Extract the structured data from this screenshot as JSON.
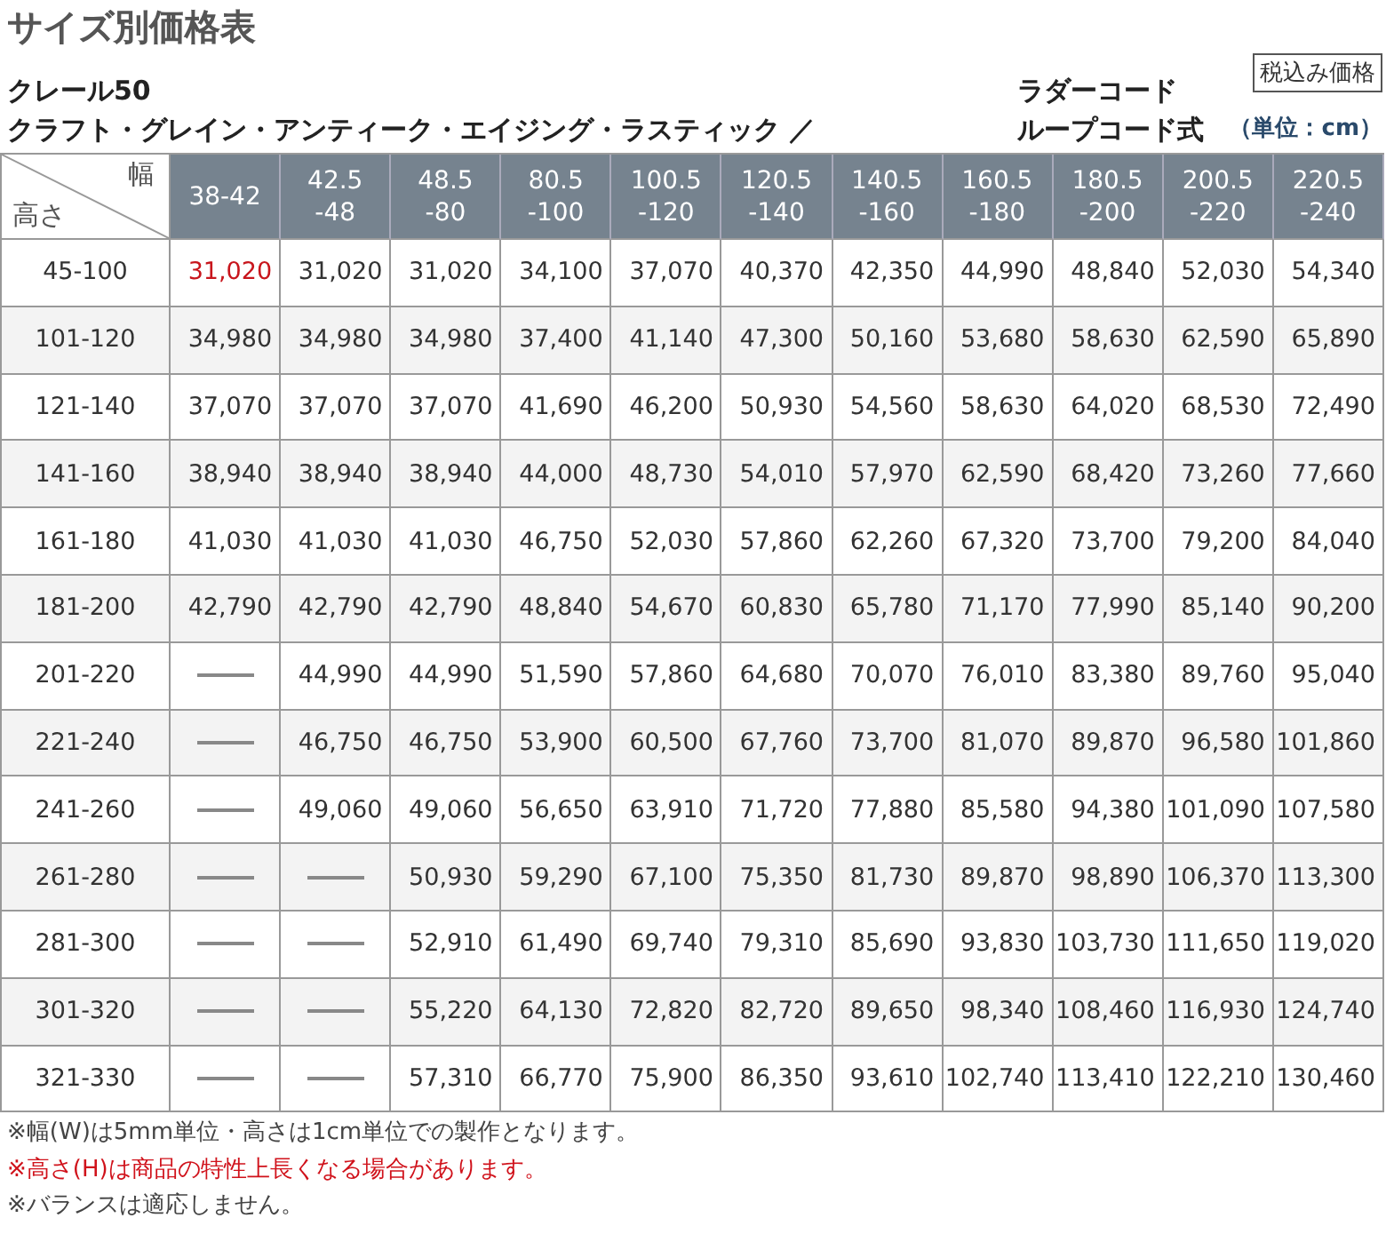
{
  "title": "サイズ別価格表",
  "product": {
    "name": "クレール50",
    "variants": "クラフト・グレイン・アンティーク・エイジング・ラスティック ／",
    "cord_lines": [
      "ラダーコード",
      "ループコード式"
    ],
    "tax_badge": "税込み価格",
    "unit": "（単位：cm）"
  },
  "table": {
    "corner_width": "幅",
    "corner_height": "高さ",
    "columns": [
      "38-42",
      "42.5\n-48",
      "48.5\n-80",
      "80.5\n-100",
      "100.5\n-120",
      "120.5\n-140",
      "140.5\n-160",
      "160.5\n-180",
      "180.5\n-200",
      "200.5\n-220",
      "220.5\n-240"
    ],
    "rows": [
      {
        "height": "45-100",
        "prices": [
          {
            "value": "31,020",
            "color": "#c8161d"
          },
          "31,020",
          "31,020",
          "34,100",
          "37,070",
          "40,370",
          "42,350",
          "44,990",
          "48,840",
          "52,030",
          "54,340"
        ]
      },
      {
        "height": "101-120",
        "prices": [
          "34,980",
          "34,980",
          "34,980",
          "37,400",
          "41,140",
          "47,300",
          "50,160",
          "53,680",
          "58,630",
          "62,590",
          "65,890"
        ]
      },
      {
        "height": "121-140",
        "prices": [
          "37,070",
          "37,070",
          "37,070",
          "41,690",
          "46,200",
          "50,930",
          "54,560",
          "58,630",
          "64,020",
          "68,530",
          "72,490"
        ]
      },
      {
        "height": "141-160",
        "prices": [
          "38,940",
          "38,940",
          "38,940",
          "44,000",
          "48,730",
          "54,010",
          "57,970",
          "62,590",
          "68,420",
          "73,260",
          "77,660"
        ]
      },
      {
        "height": "161-180",
        "prices": [
          "41,030",
          "41,030",
          "41,030",
          "46,750",
          "52,030",
          "57,860",
          "62,260",
          "67,320",
          "73,700",
          "79,200",
          "84,040"
        ]
      },
      {
        "height": "181-200",
        "prices": [
          "42,790",
          "42,790",
          "42,790",
          "48,840",
          "54,670",
          "60,830",
          "65,780",
          "71,170",
          "77,990",
          "85,140",
          "90,200"
        ]
      },
      {
        "height": "201-220",
        "prices": [
          {
            "kind": "none"
          },
          "44,990",
          "44,990",
          "51,590",
          "57,860",
          "64,680",
          "70,070",
          "76,010",
          "83,380",
          "89,760",
          "95,040"
        ]
      },
      {
        "height": "221-240",
        "prices": [
          {
            "kind": "none"
          },
          "46,750",
          "46,750",
          "53,900",
          "60,500",
          "67,760",
          "73,700",
          "81,070",
          "89,870",
          "96,580",
          "101,860"
        ]
      },
      {
        "height": "241-260",
        "prices": [
          {
            "kind": "none"
          },
          "49,060",
          "49,060",
          "56,650",
          "63,910",
          "71,720",
          "77,880",
          "85,580",
          "94,380",
          "101,090",
          "107,580"
        ]
      },
      {
        "height": "261-280",
        "prices": [
          {
            "kind": "none"
          },
          {
            "kind": "none"
          },
          "50,930",
          "59,290",
          "67,100",
          "75,350",
          "81,730",
          "89,870",
          "98,890",
          "106,370",
          "113,300"
        ]
      },
      {
        "height": "281-300",
        "prices": [
          {
            "kind": "none"
          },
          {
            "kind": "none"
          },
          "52,910",
          "61,490",
          "69,740",
          "79,310",
          "85,690",
          "93,830",
          "103,730",
          "111,650",
          "119,020"
        ]
      },
      {
        "height": "301-320",
        "prices": [
          {
            "kind": "none"
          },
          {
            "kind": "none"
          },
          "55,220",
          "64,130",
          "72,820",
          "82,720",
          "89,650",
          "98,340",
          "108,460",
          "116,930",
          "124,740"
        ]
      },
      {
        "height": "321-330",
        "prices": [
          {
            "kind": "none"
          },
          {
            "kind": "none"
          },
          "57,310",
          "66,770",
          "75,900",
          "86,350",
          "93,610",
          "102,740",
          "113,410",
          "122,210",
          "130,460"
        ]
      }
    ]
  },
  "notes": [
    {
      "text": "※幅(W)は5mm単位・高さは1cm単位での製作となります。",
      "kind": "normal"
    },
    {
      "text": "※高さ(H)は商品の特性上長くなる場合があります。",
      "kind": "warning"
    },
    {
      "text": "※バランスは適応しません。",
      "kind": "normal"
    }
  ]
}
